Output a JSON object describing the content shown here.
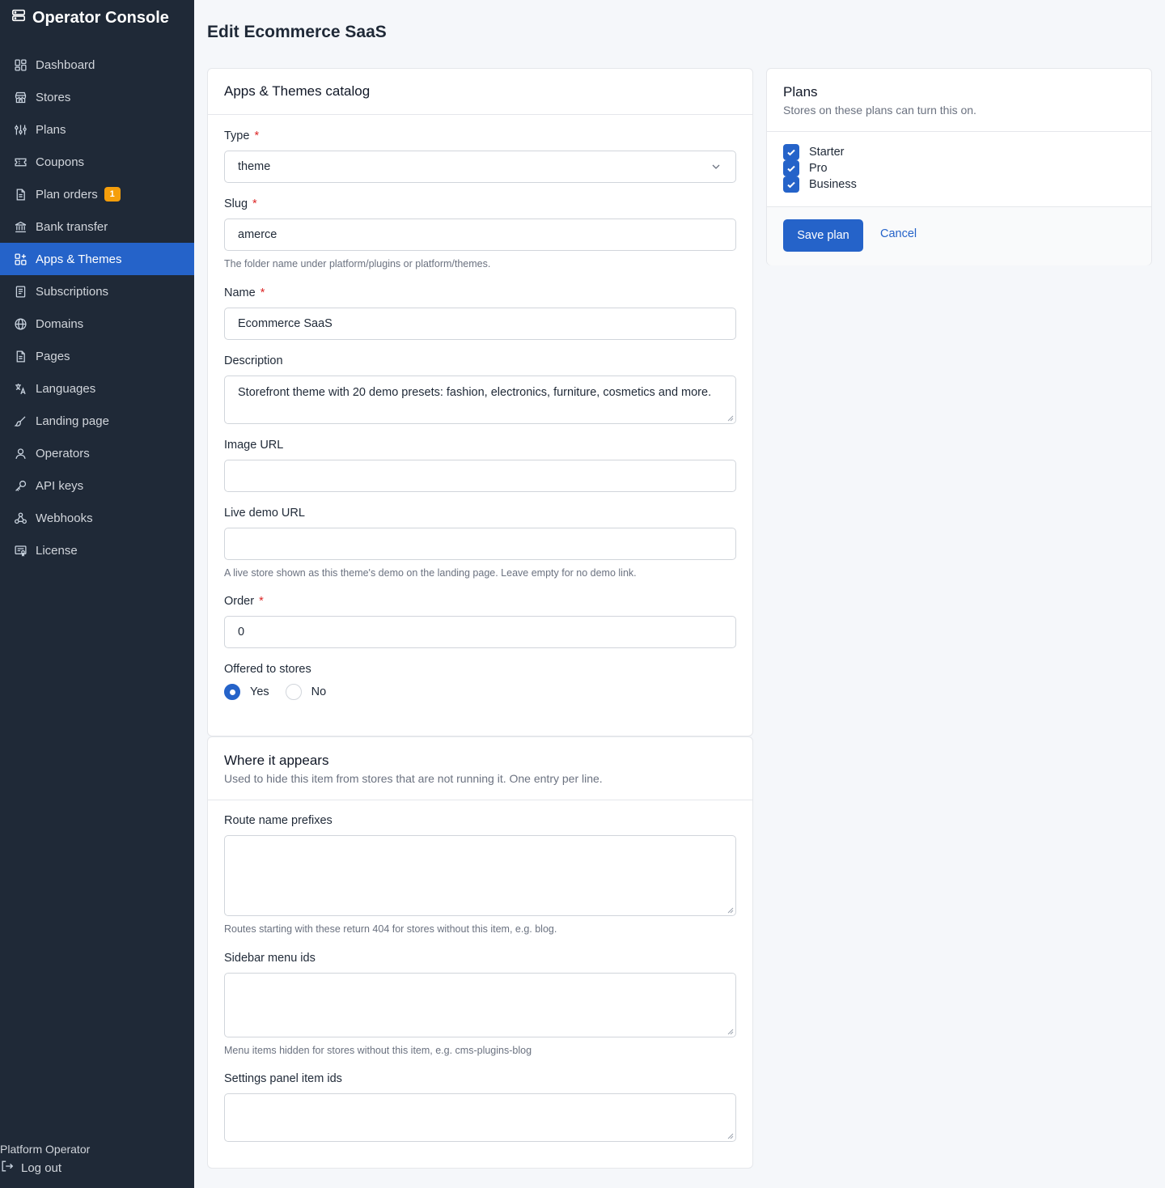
{
  "app": {
    "title": "Operator Console"
  },
  "nav": [
    {
      "label": "Dashboard",
      "icon": "dashboard-icon"
    },
    {
      "label": "Stores",
      "icon": "store-icon"
    },
    {
      "label": "Plans",
      "icon": "sliders-icon"
    },
    {
      "label": "Coupons",
      "icon": "ticket-icon"
    },
    {
      "label": "Plan orders",
      "icon": "document-icon",
      "badge": "1"
    },
    {
      "label": "Bank transfer",
      "icon": "bank-icon"
    },
    {
      "label": "Apps & Themes",
      "icon": "apps-icon",
      "active": true
    },
    {
      "label": "Subscriptions",
      "icon": "receipt-icon"
    },
    {
      "label": "Domains",
      "icon": "globe-icon"
    },
    {
      "label": "Pages",
      "icon": "page-icon"
    },
    {
      "label": "Languages",
      "icon": "translate-icon"
    },
    {
      "label": "Landing page",
      "icon": "brush-icon"
    },
    {
      "label": "Operators",
      "icon": "user-icon"
    },
    {
      "label": "API keys",
      "icon": "key-icon"
    },
    {
      "label": "Webhooks",
      "icon": "webhook-icon"
    },
    {
      "label": "License",
      "icon": "license-icon"
    }
  ],
  "footer": {
    "user": "Platform Operator",
    "logout": "Log out"
  },
  "page": {
    "title": "Edit Ecommerce SaaS"
  },
  "catalog": {
    "title": "Apps & Themes catalog",
    "type_label": "Type",
    "type_value": "theme",
    "slug_label": "Slug",
    "slug_value": "amerce",
    "slug_help": "The folder name under platform/plugins or platform/themes.",
    "name_label": "Name",
    "name_value": "Ecommerce SaaS",
    "description_label": "Description",
    "description_value": "Storefront theme with 20 demo presets: fashion, electronics, furniture, cosmetics and more.",
    "image_label": "Image URL",
    "image_value": "",
    "demo_label": "Live demo URL",
    "demo_value": "",
    "demo_help": "A live store shown as this theme's demo on the landing page. Leave empty for no demo link.",
    "order_label": "Order",
    "order_value": "0",
    "offered_label": "Offered to stores",
    "offered_yes": "Yes",
    "offered_no": "No",
    "offered_selected": "Yes",
    "required_mark": "*"
  },
  "appears": {
    "title": "Where it appears",
    "subtitle": "Used to hide this item from stores that are not running it. One entry per line.",
    "routes_label": "Route name prefixes",
    "routes_help": "Routes starting with these return 404 for stores without this item, e.g. blog.",
    "menu_label": "Sidebar menu ids",
    "menu_help": "Menu items hidden for stores without this item, e.g. cms-plugins-blog",
    "settings_label": "Settings panel item ids"
  },
  "plans": {
    "title": "Plans",
    "subtitle": "Stores on these plans can turn this on.",
    "items": [
      {
        "label": "Starter",
        "checked": true
      },
      {
        "label": "Pro",
        "checked": true
      },
      {
        "label": "Business",
        "checked": true
      }
    ],
    "save_label": "Save plan",
    "cancel_label": "Cancel"
  },
  "colors": {
    "sidebar": "#1f2937",
    "accent": "#2563c9",
    "badge": "#f59e0b",
    "required": "#dc2626"
  }
}
